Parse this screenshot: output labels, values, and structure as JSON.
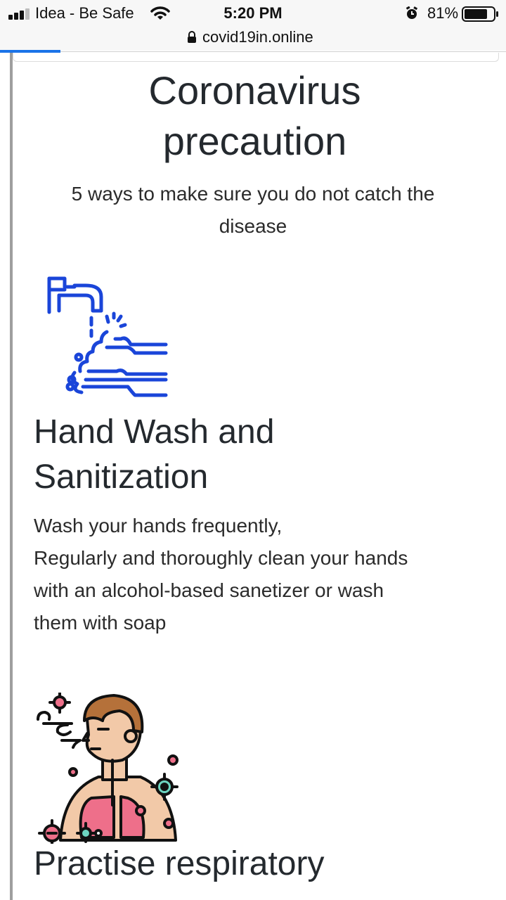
{
  "status_bar": {
    "carrier": "Idea - Be Safe",
    "time": "5:20 PM",
    "battery_pct": "81%",
    "battery_level": 0.81,
    "icons": [
      "signal-icon",
      "wifi-icon",
      "alarm-icon",
      "battery-icon"
    ]
  },
  "browser": {
    "url": "covid19in.online",
    "load_progress": 0.12
  },
  "page": {
    "title_line1": "Coronavirus",
    "title_line2": "precaution",
    "subtitle": "5 ways to make sure you do not catch the disease",
    "sections": [
      {
        "icon": "hand-wash-icon",
        "heading_line1": "Hand Wash and",
        "heading_line2": "Sanitization",
        "lines": [
          "Wash your hands frequently,",
          "Regularly and thoroughly clean your hands",
          "with an alcohol-based sanetizer or wash",
          "them with soap"
        ]
      },
      {
        "icon": "respiratory-icon",
        "heading_line1": "Practise respiratory"
      }
    ]
  },
  "colors": {
    "icon_blue": "#1a45d9",
    "progress_blue": "#1a73e8",
    "heading": "#24292e"
  }
}
